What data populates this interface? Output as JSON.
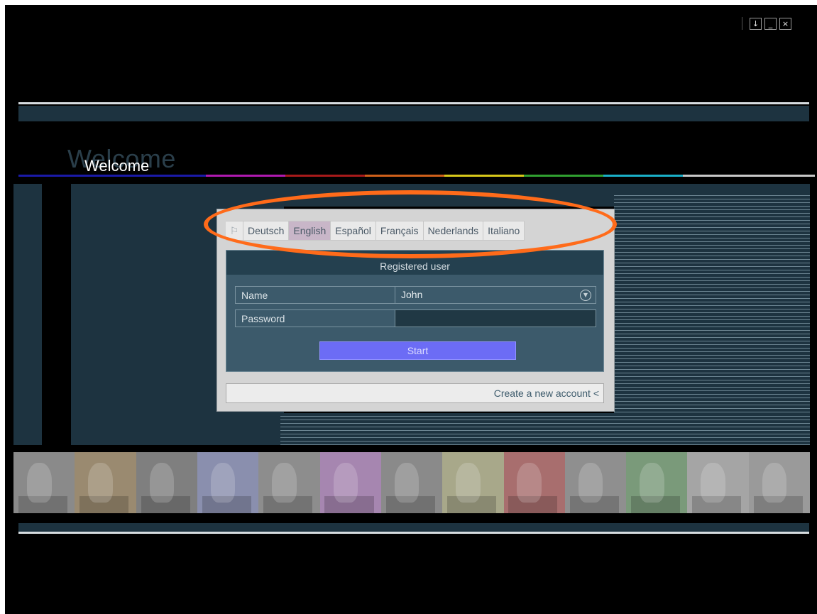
{
  "window": {
    "controls": [
      {
        "name": "download-icon",
        "glyph": "↓"
      },
      {
        "name": "minimize-icon",
        "glyph": "_"
      },
      {
        "name": "close-icon",
        "glyph": "×"
      }
    ]
  },
  "header": {
    "welcome_title": "Welcome",
    "welcome_shadow": "Welcome",
    "color_rule": [
      "#1a1aa8",
      "#1a1aa8",
      "#b01ab0",
      "#a81a1a",
      "#d0601a",
      "#d8c81a",
      "#30a030",
      "#1ab0c8",
      "#c8c8c8"
    ]
  },
  "languages": {
    "flag_icon": "flag-icon",
    "items": [
      "Deutsch",
      "English",
      "Español",
      "Français",
      "Nederlands",
      "Italiano"
    ],
    "active": "English"
  },
  "login": {
    "header": "Registered user",
    "name_label": "Name",
    "name_value": "John",
    "password_label": "Password",
    "password_value": "",
    "start_label": "Start",
    "create_account_label": "Create a new account <"
  },
  "highlight": {
    "color": "#ff6b1a"
  },
  "photo_strip": {
    "tints": [
      "#8a8a8a",
      "#9a8a70",
      "#7f7f7f",
      "#8a8fae",
      "#8d8d8d",
      "#a686b0",
      "#8a8a8a",
      "#a8a88a",
      "#a86e6e",
      "#8f8f8f",
      "#7a9a7a",
      "#a5a5a5",
      "#9a9a9a"
    ]
  }
}
